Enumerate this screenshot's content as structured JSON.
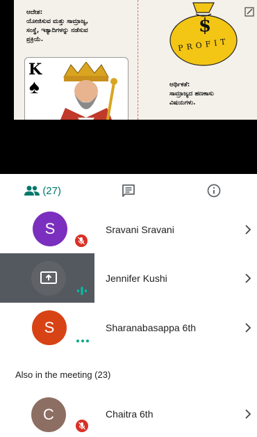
{
  "slide": {
    "left_text": "ಆದೇಶ:\nಯೋಜಿಸುವ ಮತ್ತು ಸಾಮ್ರಾಜ್ಯ,\nಸಂಸ್ಥೆ, ಇತ್ಯಾದಿಗಳನ್ನು ನಡೆಸುವ\nಪ್ರಕ್ರಿಯೆ.",
    "right_text": "ಆರ್ಥಿಕತೆ:\nಸಾಮ್ರಾಜ್ಯದ ಹಣಕಾಸು\nವಿಷಯಗಳು.",
    "card_rank": "K",
    "card_suit": "♠",
    "bag_symbol": "$",
    "bag_text": "PROFIT"
  },
  "tabs": {
    "people_count": "(27)",
    "people_icon": "people-icon",
    "chat_icon": "chat-icon",
    "info_icon": "info-icon",
    "accent": "#00796b"
  },
  "participants": [
    {
      "initial": "S",
      "name": "Sravani Sravani",
      "avatar_color": "#7b2fbe",
      "status": "muted"
    },
    {
      "initial": "",
      "name": "Jennifer Kushi",
      "avatar_color": "#5f6368",
      "status": "speaking-presenting"
    },
    {
      "initial": "S",
      "name": "Sharanabasappa 6th",
      "avatar_color": "#d84315",
      "status": "more"
    }
  ],
  "section": {
    "label": "Also in the meeting (23)"
  },
  "others": [
    {
      "initial": "C",
      "name": "Chaitra 6th",
      "avatar_color": "#8d6e63",
      "status": "muted"
    }
  ]
}
